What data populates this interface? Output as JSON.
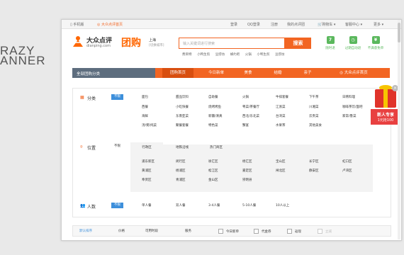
{
  "slogan": {
    "line1": "RAZY",
    "line2": "ANNER"
  },
  "topbar": {
    "left": [
      "手机版",
      "大众点评首页"
    ],
    "right": [
      "登录",
      "QQ登录",
      "注册",
      "我的点评团",
      "购物车",
      "客服中心",
      "更多"
    ]
  },
  "logo": {
    "cn": "大众点评",
    "en": "dianping.com"
  },
  "brand": "团购",
  "city": {
    "name": "上海",
    "switch": "[切换城市]"
  },
  "search": {
    "placeholder": "输入关键词进行搜索",
    "button": "搜索"
  },
  "hotwords": [
    "费目特",
    "小鸭生煎",
    "豆捞坊",
    "蜂约吧",
    "火锅",
    "小鸭生煎",
    "豆捞坊"
  ],
  "features": [
    {
      "icon": "7",
      "label": "随时退"
    },
    {
      "icon": "◷",
      "label": "过期自动退"
    },
    {
      "icon": "¥",
      "label": "不满意免单"
    }
  ],
  "nav": {
    "category_label": "全部团购分类",
    "items": [
      "团购首页",
      "今日新单",
      "美食",
      "结婚",
      "亲子",
      "大众点评首页"
    ]
  },
  "category": {
    "label": "分类",
    "unlimited": "不限",
    "items": [
      "面包",
      "甜品饮料",
      "自助餐",
      "火锅",
      "牛排套餐",
      "下午茶",
      "日韩料理",
      "西餐",
      "小吃快餐",
      "烧烤烤鱼",
      "粤菜/茶餐厅",
      "江浙菜",
      "川湘菜",
      "咖啡茶饮/面吧",
      "海鲜",
      "东南亚菜",
      "新疆/清真",
      "西北/东北菜",
      "台湾菜",
      "云贵菜",
      "家常/鲁菜",
      "汤/粥/炖菜",
      "聚餐套餐",
      "特色菜",
      "蟹宴",
      "水果茶",
      "其他美食"
    ]
  },
  "location": {
    "label": "位置",
    "unlimited": "不限",
    "tabs": [
      "行政区",
      "地铁沿线",
      "热门商区"
    ],
    "districts": [
      "浦东新区",
      "闵行区",
      "徐汇区",
      "杨汇区",
      "宝山区",
      "长宁区",
      "虹口区",
      "黄浦区",
      "杨浦区",
      "松江区",
      "嘉定区",
      "闸北区",
      "静安区",
      "卢湾区",
      "奉贤区",
      "青浦区",
      "金山区",
      "崇明县"
    ]
  },
  "people": {
    "label": "人数",
    "unlimited": "不限",
    "items": [
      "单人餐",
      "双人餐",
      "3-4人餐",
      "5-10人餐",
      "10人以上"
    ]
  },
  "sortbar": {
    "items": [
      "默认排序",
      "价格",
      "可用时段",
      "服务"
    ],
    "checks": [
      "今日新单",
      "代金券",
      "返现",
      "立减"
    ]
  },
  "gift": {
    "line1": "新人专享",
    "line2": "1元抢100"
  },
  "colors": {
    "accent": "#f26522",
    "navgray": "#5d6d7e",
    "blue": "#3d8fdb",
    "green": "#5bb85d"
  }
}
